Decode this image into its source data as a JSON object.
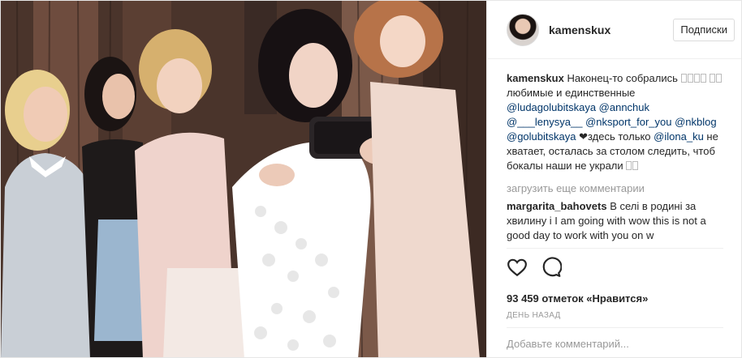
{
  "post": {
    "username": "kamenskux",
    "follow_label": "Подписки",
    "caption": {
      "username": "kamenskux",
      "text_1": "Наконец-то собрались",
      "text_2": "любимые и единственные",
      "mention_1": "@ludagolubitskaya",
      "mention_2": "@annchuk",
      "mention_3": "@___lenysya__",
      "mention_4": "@nksport_for_you",
      "mention_5": "@nkblog",
      "mention_6": "@golubitskaya",
      "text_3": "❤здесь только",
      "mention_7": "@ilona_ku",
      "text_4": "не хватает, осталась за столом следить, чтоб бокалы наши не украли"
    },
    "load_more_label": "загрузить еще комментарии",
    "comment": {
      "username": "margarita_bahovets",
      "text": "В селі в родині за хвилину і I am going with wow this is not a good day to work with you on w"
    },
    "likes_text": "93 459 отметок «Нравится»",
    "time_text": "ДЕНЬ НАЗАД",
    "add_comment_placeholder": "Добавьте комментарий..."
  },
  "icons": {
    "like": "heart-icon",
    "comment": "speech-bubble-icon"
  },
  "colors": {
    "mention": "#003569",
    "muted": "#999999",
    "text": "#262626"
  }
}
